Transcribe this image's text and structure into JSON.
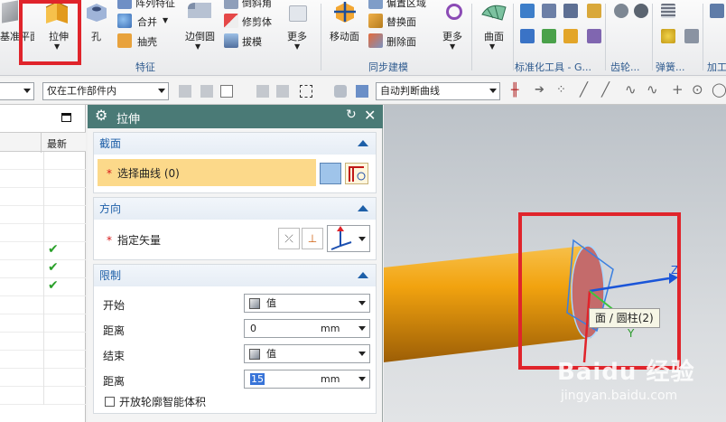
{
  "ribbon": {
    "datum_plane_label": "基准平面",
    "extrude_label": "拉伸",
    "hole_label": "孔",
    "pattern_feature_label": "阵列特征",
    "combine_label": "合并",
    "shell_label": "抽壳",
    "edge_blend_label": "边倒圆",
    "chamfer_label": "倒斜角",
    "trim_body_label": "修剪体",
    "draft_label": "拔模",
    "more_label_1": "更多",
    "feature_group": "特征",
    "move_face_label": "移动面",
    "offset_region_label": "偏置区域",
    "replace_face_label": "替换面",
    "delete_face_label": "删除面",
    "more_label_2": "更多",
    "sync_group": "同步建模",
    "surface_label": "曲面",
    "std_tools_group": "标准化工具 - G...",
    "gear_group": "齿轮...",
    "spring_group": "弹簧...",
    "machining_group": "加工"
  },
  "toolbar": {
    "filter_combo": "",
    "scope_combo": "仅在工作部件内",
    "curve_rule_combo": "自动判断曲线"
  },
  "left_panel": {
    "col_newest": "最新"
  },
  "dialog": {
    "title": "拉伸",
    "section_header": "截面",
    "select_curve": "选择曲线 (0)",
    "direction_header": "方向",
    "specify_vector": "指定矢量",
    "limits_header": "限制",
    "start_label": "开始",
    "start_value": "值",
    "distance_label_1": "距离",
    "distance_value_1": "0",
    "unit_1": "mm",
    "end_label": "结束",
    "end_value": "值",
    "distance_label_2": "距离",
    "distance_value_2": "15",
    "unit_2": "mm",
    "open_profile": "开放轮廓智能体积"
  },
  "viewport": {
    "tooltip": "面 / 圆柱(2)",
    "axis_z": "Z",
    "axis_y": "Y",
    "watermark_brand": "Baidu 经验",
    "watermark_url": "jingyan.baidu.com",
    "colors": {
      "cylinder": "#f2a30f",
      "face": "#c97070",
      "highlight": "#e0242b",
      "z_axis": "#1a55d8",
      "y_axis": "#3cc43c",
      "x_axis": "#e0242b"
    }
  }
}
